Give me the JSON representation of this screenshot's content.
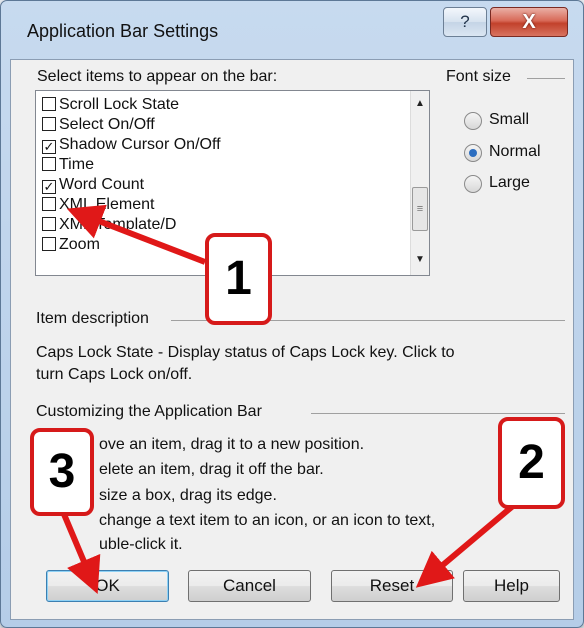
{
  "window": {
    "title": "Application Bar Settings",
    "help_glyph": "?",
    "close_glyph": "X"
  },
  "items_section": {
    "label": "Select items to appear on the bar:",
    "items": [
      {
        "label": "Scroll Lock State",
        "checked": false
      },
      {
        "label": "Select On/Off",
        "checked": false
      },
      {
        "label": "Shadow Cursor On/Off",
        "checked": true
      },
      {
        "label": "Time",
        "checked": false
      },
      {
        "label": "Word Count",
        "checked": true
      },
      {
        "label": "XML Element",
        "checked": false
      },
      {
        "label": "XML Template/D",
        "checked": false
      },
      {
        "label": "Zoom",
        "checked": false
      }
    ],
    "scroll_up_glyph": "▲",
    "scroll_down_glyph": "▼",
    "scroll_thumb_glyph": "≡"
  },
  "font_size": {
    "label": "Font size",
    "options": [
      {
        "label": "Small",
        "selected": false
      },
      {
        "label": "Normal",
        "selected": true
      },
      {
        "label": "Large",
        "selected": false
      }
    ]
  },
  "item_description": {
    "label": "Item description",
    "line1": "Caps Lock State - Display status of Caps Lock key.  Click to",
    "line2": "turn Caps Lock on/off."
  },
  "customizing": {
    "label": "Customizing the Application Bar",
    "line1": "ove an item, drag it to a new position.",
    "line2": "elete an item, drag it off the bar.",
    "line3": "size a box, drag its edge.",
    "line4": "change a text item to an icon, or an icon to text,",
    "line5": "uble-click it."
  },
  "buttons": {
    "ok": "OK",
    "cancel": "Cancel",
    "reset": "Reset",
    "help": "Help"
  },
  "callouts": {
    "one": "1",
    "two": "2",
    "three": "3"
  },
  "colors": {
    "callout_border": "#d61a1a",
    "arrow": "#e01818"
  }
}
